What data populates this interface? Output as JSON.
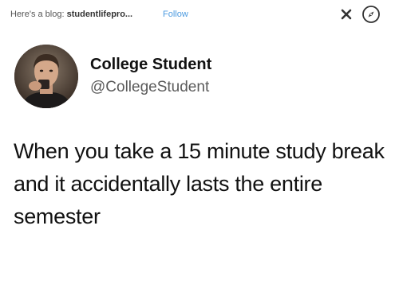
{
  "header": {
    "blog_prefix": "Here's a blog: ",
    "blog_name": "studentlifepro...",
    "follow_label": "Follow"
  },
  "icons": {
    "close": "close-icon",
    "compass": "compass-icon"
  },
  "tweet": {
    "display_name": "College Student",
    "handle": "@CollegeStudent",
    "text": "When you take a 15 minute study break and it accidentally lasts the entire semester"
  },
  "colors": {
    "follow_link": "#4d9be0",
    "text": "#111111",
    "handle": "#5a5a5a"
  }
}
